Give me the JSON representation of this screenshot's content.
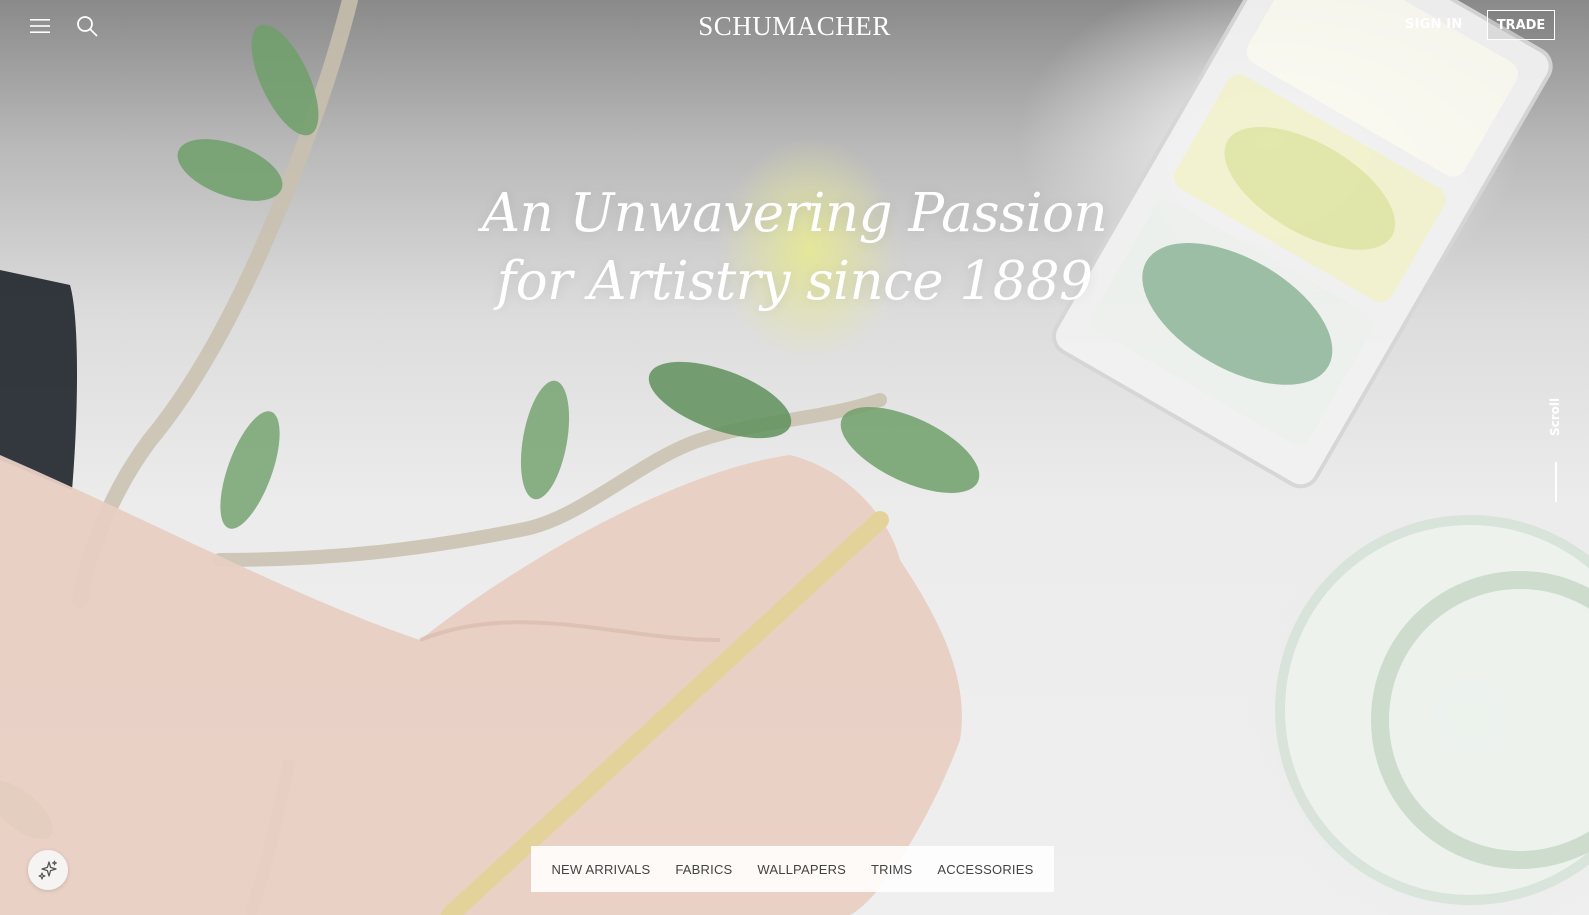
{
  "header": {
    "brand": "SCHUMACHER",
    "sign_in_label": "SIGN IN",
    "trade_label": "TRADE"
  },
  "hero": {
    "headline_line1": "An Unwavering Passion",
    "headline_line2": "for Artistry since 1889",
    "scroll_label": "Scroll"
  },
  "category_nav": {
    "items": [
      {
        "label": "NEW ARRIVALS"
      },
      {
        "label": "FABRICS"
      },
      {
        "label": "WALLPAPERS"
      },
      {
        "label": "TRIMS"
      },
      {
        "label": "ACCESSORIES"
      }
    ]
  },
  "icons": {
    "menu": "hamburger-menu-icon",
    "search": "search-icon",
    "assistant": "sparkles-icon"
  },
  "colors": {
    "header_text": "#ffffff",
    "nav_background": "#ffffff",
    "nav_text": "#444444"
  }
}
